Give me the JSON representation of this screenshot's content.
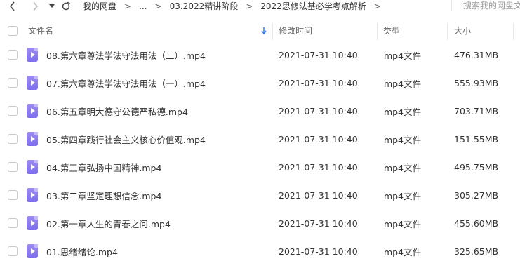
{
  "nav": {
    "back_icon": "chevron-left-icon",
    "forward_icon": "chevron-right-icon",
    "history_icon": "caret-down-icon",
    "refresh_icon": "refresh-icon"
  },
  "breadcrumb": [
    "我的网盘",
    "...",
    "03.2022精讲阶段",
    "2022思修法基必学考点解析"
  ],
  "search": {
    "placeholder": "搜索我的网盘文"
  },
  "columns": {
    "name": "文件名",
    "modified": "修改时间",
    "type": "类型",
    "size": "大小"
  },
  "colors": {
    "icon": "#8b7bf0",
    "sort_arrow": "#3b7ff5"
  },
  "files": [
    {
      "name": "08.第六章尊法学法守法用法（二）.mp4",
      "modified": "2021-07-31 10:40",
      "type": "mp4文件",
      "size": "476.31MB"
    },
    {
      "name": "07.第六章尊法学法守法用法（一）.mp4",
      "modified": "2021-07-31 10:40",
      "type": "mp4文件",
      "size": "555.93MB"
    },
    {
      "name": "06.第五章明大德守公德严私德.mp4",
      "modified": "2021-07-31 10:40",
      "type": "mp4文件",
      "size": "703.71MB"
    },
    {
      "name": "05.第四章践行社会主义核心价值观.mp4",
      "modified": "2021-07-31 10:40",
      "type": "mp4文件",
      "size": "151.55MB"
    },
    {
      "name": "04.第三章弘扬中国精神.mp4",
      "modified": "2021-07-31 10:40",
      "type": "mp4文件",
      "size": "495.75MB"
    },
    {
      "name": "03.第二章坚定理想信念.mp4",
      "modified": "2021-07-31 10:40",
      "type": "mp4文件",
      "size": "305.27MB"
    },
    {
      "name": "02.第一章人生的青春之问.mp4",
      "modified": "2021-07-31 10:40",
      "type": "mp4文件",
      "size": "455.60MB"
    },
    {
      "name": "01.思绪绪论.mp4",
      "modified": "2021-07-31 10:40",
      "type": "mp4文件",
      "size": "325.65MB"
    }
  ]
}
